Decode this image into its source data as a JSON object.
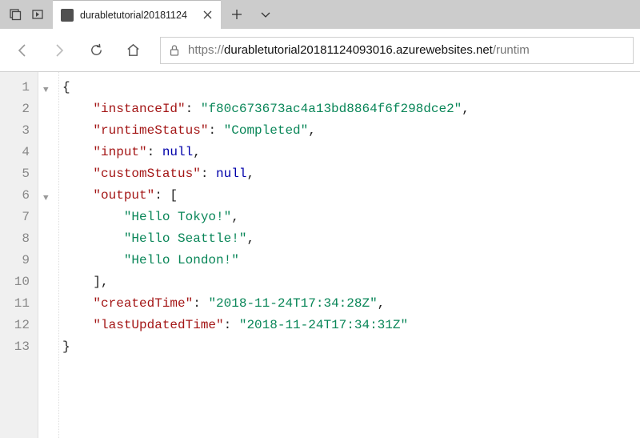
{
  "window": {
    "tab_title": "durabletutorial20181124",
    "new_tab_tooltip": "+",
    "chevron_tooltip": "v"
  },
  "address": {
    "protocol": "https://",
    "host": "durabletutorial20181124093016.azurewebsites.net",
    "path": "/runtim"
  },
  "gutter_lines": [
    "1",
    "2",
    "3",
    "4",
    "5",
    "6",
    "7",
    "8",
    "9",
    "10",
    "11",
    "12",
    "13"
  ],
  "json_view": {
    "instanceId_key": "\"instanceId\"",
    "instanceId_val": "\"f80c673673ac4a13bd8864f6f298dce2\"",
    "runtimeStatus_key": "\"runtimeStatus\"",
    "runtimeStatus_val": "\"Completed\"",
    "input_key": "\"input\"",
    "input_val": "null",
    "customStatus_key": "\"customStatus\"",
    "customStatus_val": "null",
    "output_key": "\"output\"",
    "output_0": "\"Hello Tokyo!\"",
    "output_1": "\"Hello Seattle!\"",
    "output_2": "\"Hello London!\"",
    "createdTime_key": "\"createdTime\"",
    "createdTime_val": "\"2018-11-24T17:34:28Z\"",
    "lastUpdatedTime_key": "\"lastUpdatedTime\"",
    "lastUpdatedTime_val": "\"2018-11-24T17:34:31Z\""
  }
}
